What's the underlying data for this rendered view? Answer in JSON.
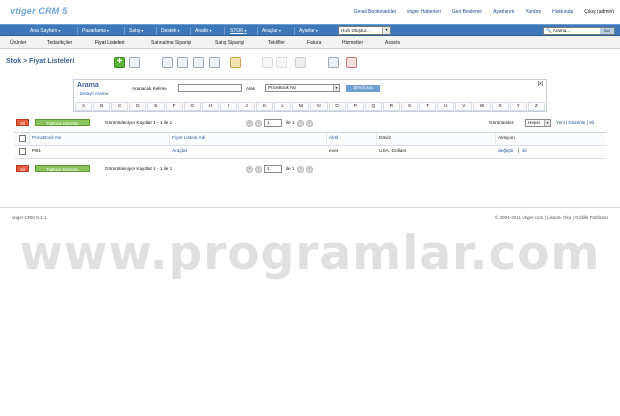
{
  "app": {
    "logo": "vtiger CRM 5"
  },
  "toplinks": [
    "Gmail Bookmarklet",
    "vtiger Haberleri",
    "Geri Besleme",
    "Ayarlarım",
    "Yardım",
    "Hakkında",
    "Çıkış (admin)"
  ],
  "nav": {
    "items": [
      "Ana Sayfam",
      "Pazarlama",
      "Satış",
      "Destek",
      "Analiz",
      "STOK",
      "Araçlar",
      "Ayarlar"
    ],
    "quick_create": "Hızlı Oluştur...",
    "search_placeholder": "Arama...",
    "search_go": "Bul"
  },
  "subnav": [
    "Ürünler",
    "Tedarikçiler",
    "Fiyat Listeleri",
    "Satınalma Siparişi",
    "Satış Siparişi",
    "Teklifler",
    "Fatura",
    "Hizmetler",
    "Assets"
  ],
  "breadcrumb": "Stok > Fiyat Listeleri",
  "search": {
    "title": "Arama",
    "advanced": "- Detaylı Arama",
    "keyword_label": "Aranacak Kelime",
    "keyword_value": "",
    "field_label": "Alan",
    "field_value": "PriceBook No",
    "button": "Şimdi ara",
    "close": "[x]",
    "alphabet": [
      "A",
      "B",
      "C",
      "D",
      "E",
      "F",
      "G",
      "H",
      "I",
      "J",
      "K",
      "L",
      "M",
      "N",
      "O",
      "P",
      "Q",
      "R",
      "S",
      "T",
      "U",
      "V",
      "W",
      "X",
      "Y",
      "Z"
    ]
  },
  "actions": {
    "delete": "Sil",
    "mass_edit": "Topluca Düzenle",
    "records_text": "Görüntüleniyor Kayıtlar 1 - 1 ile 1",
    "page_value": "1",
    "page_of": "ile 1",
    "views_label": "Görünümler:",
    "views_value": "Hepsi",
    "views_links": "Yeni | Düzenle | Sil"
  },
  "table": {
    "headers": [
      "PriceBook No",
      "Fiyat Listesi Adı",
      "Aktif",
      "Döviz",
      "Aksiyon"
    ],
    "rows": [
      {
        "no": "PB1",
        "name": "Araçlar",
        "active": "evet",
        "currency": "USA, Dollars",
        "action_edit": "değiştir",
        "action_sep": "|",
        "action_del": "sil"
      }
    ]
  },
  "footer": {
    "left": "vtiger CRM 5.2.1",
    "right": "© 2004-2011 vtiger.com | Lisansı Oku | Gizlilik Politikası"
  },
  "watermark": "www.programlar.com"
}
